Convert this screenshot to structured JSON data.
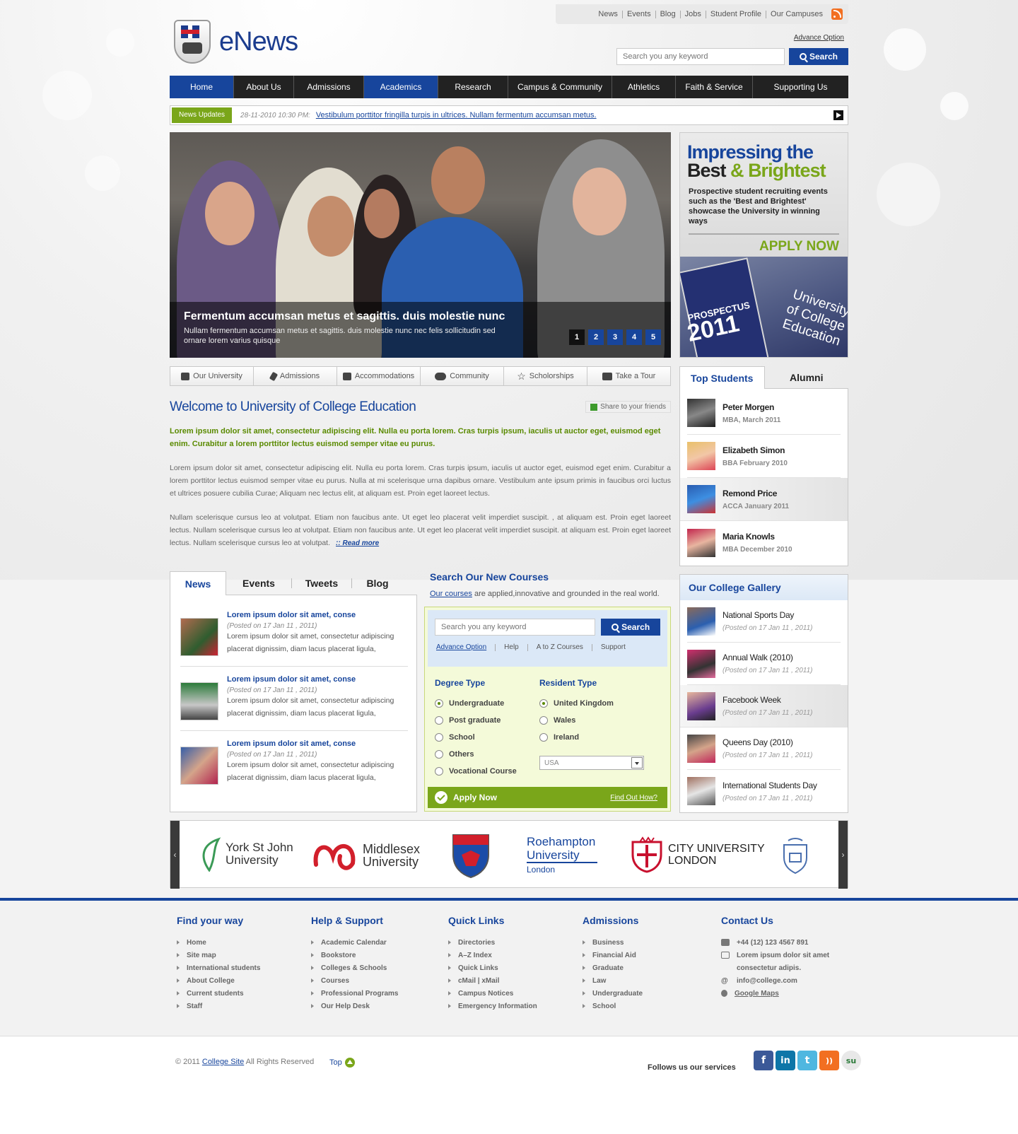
{
  "header": {
    "logo_text": "eNews",
    "top_links": [
      "News",
      "Events",
      "Blog",
      "Jobs",
      "Student Profile",
      "Our Campuses"
    ],
    "advance_option": "Advance Option",
    "search_placeholder": "Search you any keyword",
    "search_button": "Search"
  },
  "nav": [
    "Home",
    "About Us",
    "Admissions",
    "Academics",
    "Research",
    "Campus & Community",
    "Athletics",
    "Faith & Service",
    "Supporting Us"
  ],
  "ticker": {
    "label": "News Updates",
    "date": "28-11-2010 10:30 PM:",
    "message": "Vestibulum porttitor fringilla turpis in ultrices. Nullam fermentum accumsan metus."
  },
  "hero": {
    "title": "Fermentum accumsan metus et sagittis. duis molestie nunc",
    "text": "Nullam fermentum accumsan metus et sagittis. duis molestie nunc nec felis sollicitudin sed ornare lorem varius quisque",
    "pages": [
      "1",
      "2",
      "3",
      "4",
      "5"
    ]
  },
  "promo": {
    "line1": "Impressing the",
    "line2a": "Best",
    "line2b": "&",
    "line2c": "Brightest",
    "text": "Prospective student recruiting events such as the 'Best and Brightest' showcase the University in winning ways",
    "apply": "APPLY NOW",
    "prospectus": "PROSPECTUS",
    "year": "2011",
    "uni1": "University",
    "uni2": "of College",
    "uni3": "Education"
  },
  "quick_tabs": [
    "Our University",
    "Admissions",
    "Accommodations",
    "Community",
    "Scholorships",
    "Take a Tour"
  ],
  "welcome": {
    "title": "Welcome to University of College Education",
    "share": "Share to your friends",
    "lead": "Lorem ipsum dolor sit amet, consectetur adipiscing elit. Nulla eu porta lorem. Cras turpis ipsum, iaculis ut auctor eget, euismod eget enim. Curabitur a lorem porttitor lectus euismod semper vitae eu purus.",
    "p1": "Lorem ipsum dolor sit amet, consectetur adipiscing elit. Nulla eu porta lorem. Cras turpis ipsum, iaculis ut auctor eget, euismod eget enim. Curabitur a lorem porttitor lectus euismod semper vitae eu purus. Nulla at mi scelerisque urna dapibus ornare. Vestibulum ante ipsum primis in faucibus orci luctus et ultrices posuere cubilia Curae; Aliquam nec lectus elit, at aliquam est. Proin eget laoreet lectus.",
    "p2": "Nullam scelerisque cursus leo at volutpat. Etiam non faucibus ante. Ut eget leo placerat velit imperdiet suscipit. , at aliquam est. Proin eget laoreet lectus. Nullam scelerisque cursus leo at volutpat. Etiam non faucibus ante. Ut eget leo placerat velit imperdiet suscipit.  at aliquam est. Proin eget laoreet lectus. Nullam scelerisque cursus leo at volutpat.",
    "readmore": ":: Read more"
  },
  "news_tabs": [
    "News",
    "Events",
    "Tweets",
    "Blog"
  ],
  "news_items": [
    {
      "title": "Lorem ipsum dolor sit amet, conse",
      "posted": "(Posted on 17 Jan 11 , 2011)",
      "excerpt": "Lorem ipsum dolor sit amet, consectetur adipiscing placerat dignissim, diam lacus placerat ligula,"
    },
    {
      "title": "Lorem ipsum dolor sit amet, conse",
      "posted": "(Posted on 17 Jan 11 , 2011)",
      "excerpt": "Lorem ipsum dolor sit amet, consectetur adipiscing placerat dignissim, diam lacus placerat ligula,"
    },
    {
      "title": "Lorem ipsum dolor sit amet, conse",
      "posted": "(Posted on 17 Jan 11 , 2011)",
      "excerpt": "Lorem ipsum dolor sit amet, consectetur adipiscing placerat dignissim, diam lacus placerat ligula,"
    }
  ],
  "courses": {
    "title": "Search Our New Courses",
    "sub_link": "Our courses",
    "sub_text": " are applied,innovative and grounded in the real world.",
    "placeholder": "Search you any keyword",
    "button": "Search",
    "links": [
      "Advance Option",
      "Help",
      "A to Z Courses",
      "Support"
    ],
    "degree_title": "Degree Type",
    "degree_options": [
      "Undergraduate",
      "Post graduate",
      "School",
      "Others",
      "Vocational Course"
    ],
    "resident_title": "Resident Type",
    "resident_options": [
      "United Kingdom",
      "Wales",
      "Ireland"
    ],
    "country_selected": "USA",
    "apply": "Apply Now",
    "find_out": "Find Out How?"
  },
  "side_tabs": [
    "Top Students",
    "Alumni"
  ],
  "students": [
    {
      "name": "Peter Morgen",
      "detail": "MBA, March 2011"
    },
    {
      "name": "Elizabeth Simon",
      "detail": "BBA February 2010"
    },
    {
      "name": "Remond Price",
      "detail": "ACCA January 2011"
    },
    {
      "name": "Maria Knowls",
      "detail": "MBA December 2010"
    }
  ],
  "gallery": {
    "title": "Our College Gallery",
    "items": [
      {
        "name": "National Sports Day",
        "posted": "(Posted on 17 Jan 11 , 2011)"
      },
      {
        "name": "Annual Walk (2010)",
        "posted": "(Posted on 17 Jan 11 , 2011)"
      },
      {
        "name": "Facebook Week",
        "posted": "(Posted on 17 Jan 11 , 2011)"
      },
      {
        "name": "Queens Day (2010)",
        "posted": "(Posted on 17 Jan 11 , 2011)"
      },
      {
        "name": "International Students Day",
        "posted": "(Posted on 17 Jan 11 , 2011)"
      }
    ]
  },
  "partners": {
    "york1": "York St John",
    "york2": "University",
    "mdx1": "Middlesex",
    "mdx2": "University",
    "roe1": "Roehampton",
    "roe2": "University",
    "roe3": "London",
    "city1": "CITY UNIVERSITY",
    "city2": "LONDON"
  },
  "footer": {
    "find_title": "Find your way",
    "find": [
      "Home",
      "Site map",
      "International students",
      "About College",
      "Current students",
      "Staff"
    ],
    "help_title": "Help & Support",
    "help": [
      "Academic Calendar",
      "Bookstore",
      "Colleges & Schools",
      "Courses",
      "Professional Programs",
      "Our Help Desk"
    ],
    "quick_title": "Quick Links",
    "quick": [
      "Directories",
      "A–Z Index",
      "Quick Links",
      "cMail | xMail",
      "Campus Notices",
      "Emergency Information"
    ],
    "adm_title": "Admissions",
    "adm": [
      "Business",
      "Financial Aid",
      "Graduate",
      "Law",
      "Undergraduate",
      "School"
    ],
    "contact_title": "Contact Us",
    "phone": "+44 (12) 123 4567 891",
    "addr1": "Lorem ipsum dolor sit amet",
    "addr2": "consectetur adipis.",
    "email": "info@college.com",
    "maps": "Google Maps"
  },
  "bottom": {
    "copy_pre": "© 2011 ",
    "copy_link": "College Site",
    "copy_post": " All Rights Reserved",
    "top": "Top",
    "follow": "Follows us our services"
  },
  "colors": {
    "brand_blue": "#17459c",
    "accent_green": "#7aa61a"
  }
}
